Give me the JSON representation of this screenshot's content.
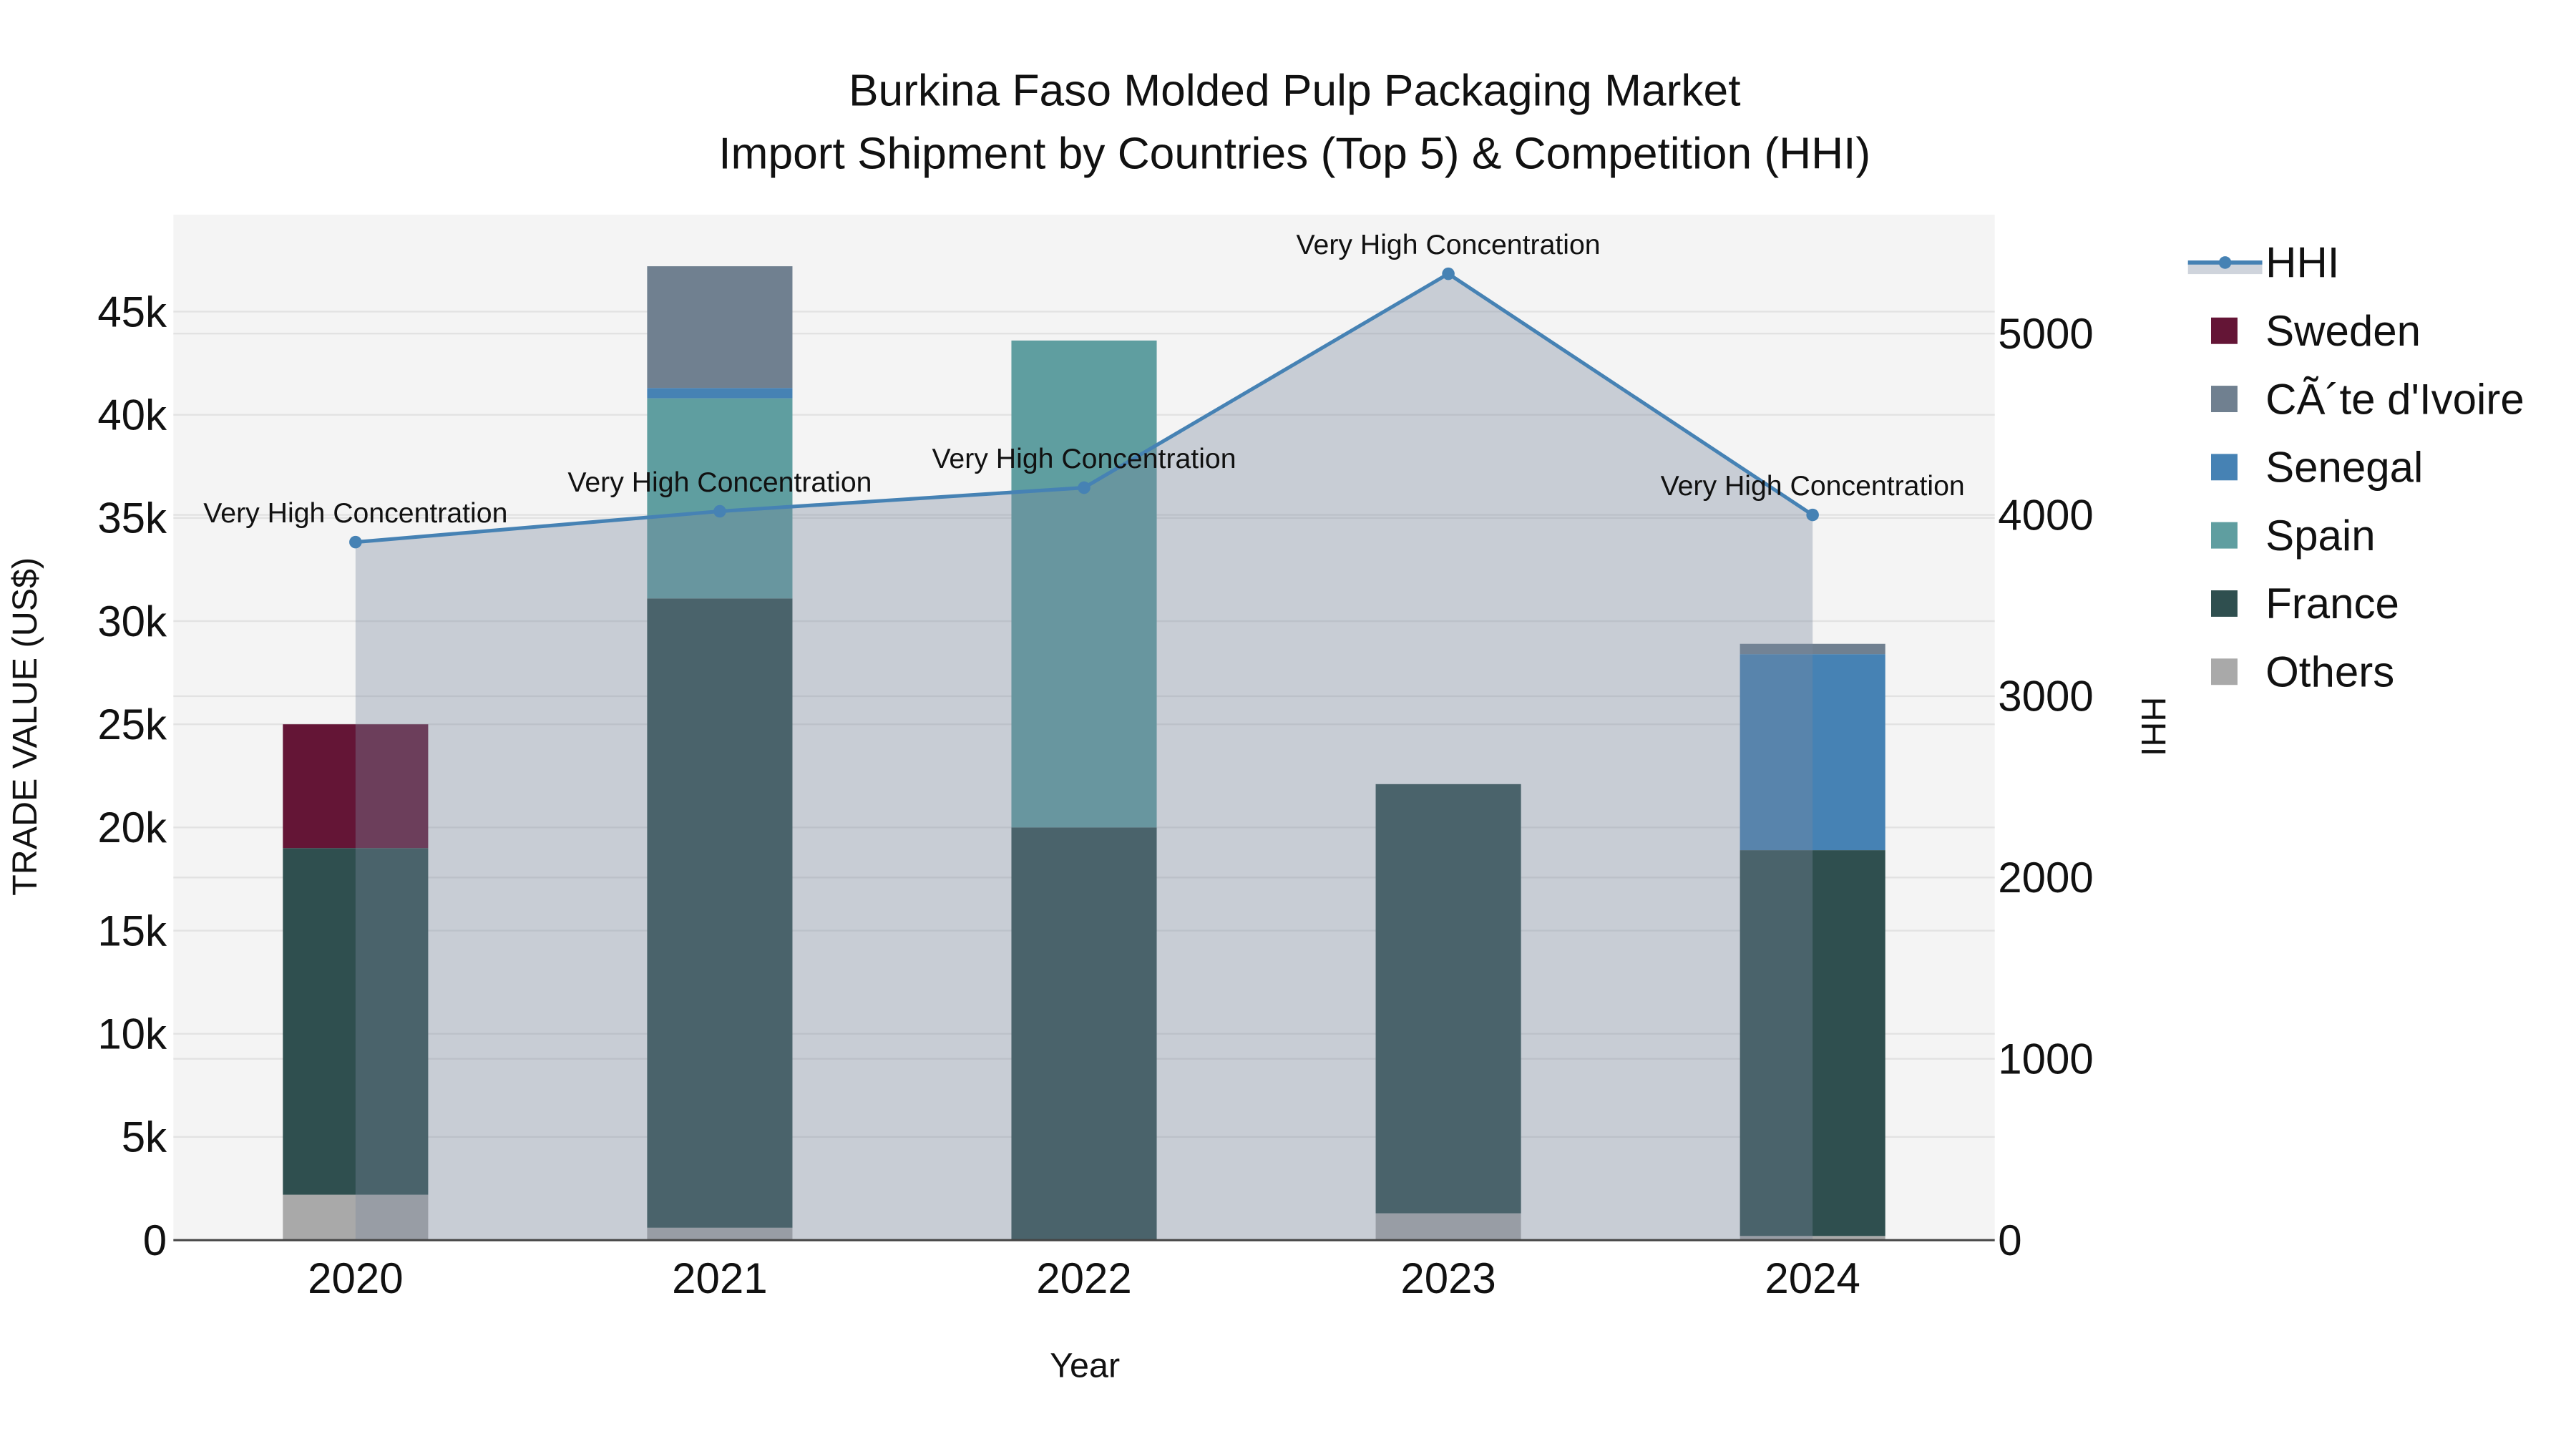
{
  "chart_data": {
    "type": "bar",
    "title": "Burkina Faso Molded Pulp Packaging Market",
    "subtitle": "Import Shipment by Countries (Top 5) & Competition (HHI)",
    "xlabel": "Year",
    "ylabel": "TRADE VALUE (US$)",
    "y2label": "HHI",
    "categories": [
      "2020",
      "2021",
      "2022",
      "2023",
      "2024"
    ],
    "ylim": [
      0,
      49700
    ],
    "y2lim": [
      0,
      5656
    ],
    "yticks": [
      0,
      5000,
      10000,
      15000,
      20000,
      25000,
      30000,
      35000,
      40000,
      45000
    ],
    "ytick_labels": [
      "0",
      "5k",
      "10k",
      "15k",
      "20k",
      "25k",
      "30k",
      "35k",
      "40k",
      "45k"
    ],
    "y2ticks": [
      0,
      1000,
      2000,
      3000,
      4000,
      5000
    ],
    "y2tick_labels": [
      "0",
      "1000",
      "2000",
      "3000",
      "4000",
      "5000"
    ],
    "grid": true,
    "stacked": true,
    "series": [
      {
        "name": "Others",
        "color": "#a9a9a9",
        "values": [
          2200,
          600,
          0,
          1300,
          200
        ]
      },
      {
        "name": "France",
        "color": "#2f4f4f",
        "values": [
          16800,
          30500,
          20000,
          20800,
          18700
        ]
      },
      {
        "name": "Spain",
        "color": "#5f9ea0",
        "values": [
          0,
          9700,
          23600,
          0,
          0
        ]
      },
      {
        "name": "Senegal",
        "color": "#4682b4",
        "values": [
          0,
          500,
          0,
          0,
          9500
        ]
      },
      {
        "name": "CÃ´te d'Ivoire",
        "color": "#708090",
        "values": [
          0,
          5900,
          0,
          0,
          500
        ]
      },
      {
        "name": "Sweden",
        "color": "#641536",
        "values": [
          6000,
          0,
          0,
          0,
          0
        ]
      }
    ],
    "hhi": {
      "name": "HHI",
      "color": "#4682b4",
      "values": [
        3850,
        4020,
        4150,
        5330,
        4000
      ],
      "annotations": [
        "Very High Concentration",
        "Very High Concentration",
        "Very High Concentration",
        "Very High Concentration",
        "Very High Concentration"
      ]
    },
    "legend": [
      "HHI",
      "Sweden",
      "CÃ´te d'Ivoire",
      "Senegal",
      "Spain",
      "France",
      "Others"
    ],
    "legend_placement": "top-right"
  }
}
